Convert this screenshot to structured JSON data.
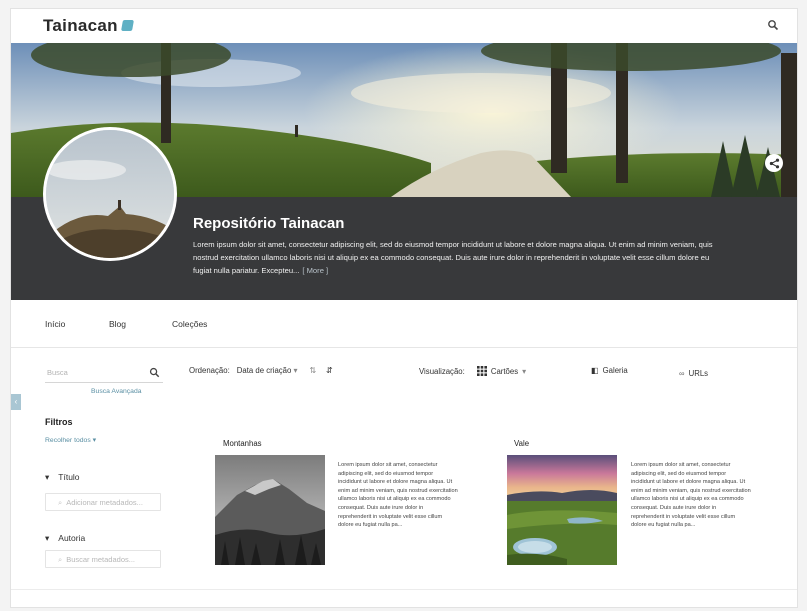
{
  "header": {
    "logo_text": "Tainacan",
    "search_icon": "search-icon"
  },
  "banner": {
    "share_icon": "share-icon"
  },
  "repository": {
    "title": "Repositório Tainacan",
    "description": "Lorem ipsum dolor sit amet, consectetur adipiscing elit, sed do eiusmod tempor incididunt ut labore et dolore magna aliqua. Ut enim ad minim veniam, quis nostrud exercitation ullamco laboris nisi ut aliquip ex ea commodo consequat. Duis aute irure dolor in reprehenderit in voluptate velit esse cillum dolore eu fugiat nulla pariatur. Excepteu...",
    "more_label": "[ More ]"
  },
  "nav": {
    "items": [
      {
        "label": "Início"
      },
      {
        "label": "Blog"
      },
      {
        "label": "Coleções"
      }
    ]
  },
  "sidebar": {
    "search_placeholder": "Busca",
    "advanced_search": "Busca Avançada",
    "filters_title": "Filtros",
    "collapse_all": "Recolher todos",
    "filters": [
      {
        "label": "Título",
        "placeholder": "Adicionar metadados..."
      },
      {
        "label": "Autoria",
        "placeholder": "Buscar metadados..."
      }
    ],
    "collapse_tab_icon": "chevron-left-icon"
  },
  "toolbar": {
    "sort_label": "Ordenação:",
    "sort_value": "Data de criação",
    "view_label": "Visualização:",
    "view_value": "Cartões",
    "gallery_label": "Galeria",
    "urls_label": "URLs"
  },
  "items": [
    {
      "title": "Montanhas",
      "text": "Lorem ipsum dolor sit amet, consectetur adipiscing elit, sed do eiusmod tempor incididunt ut labore et dolore magna aliqua. Ut enim ad minim veniam, quis nostrud exercitation ullamco laboris nisi ut aliquip ex ea commodo consequat. Duis aute irure dolor in reprehenderit in voluptate velit esse cillum dolore eu fugiat nulla pa..."
    },
    {
      "title": "Vale",
      "text": "Lorem ipsum dolor sit amet, consectetur adipiscing elit, sed do eiusmod tempor incididunt ut labore et dolore magna aliqua. Ut enim ad minim veniam, quis nostrud exercitation ullamco laboris nisi ut aliquip ex ea commodo consequat. Duis aute irure dolor in reprehenderit in voluptate velit esse cillum dolore eu fugiat nulla pa..."
    }
  ]
}
